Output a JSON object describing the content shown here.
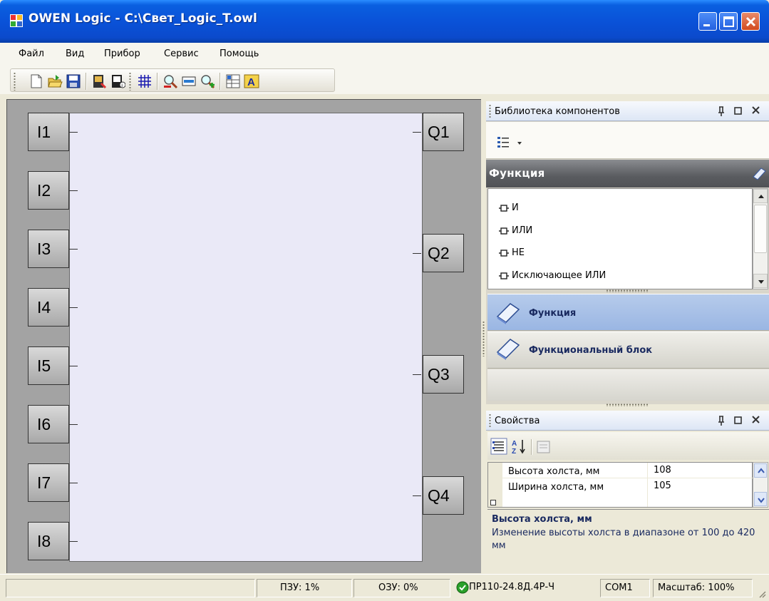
{
  "window": {
    "title": "OWEN Logic - C:\\Свет_Logic_T.owl"
  },
  "menu": [
    "Файл",
    "Вид",
    "Прибор",
    "Сервис",
    "Помощь"
  ],
  "canvas": {
    "inputs": [
      "I1",
      "I2",
      "I3",
      "I4",
      "I5",
      "I6",
      "I7",
      "I8"
    ],
    "outputs": [
      "Q1",
      "Q2",
      "Q3",
      "Q4"
    ]
  },
  "library": {
    "title": "Библиотека компонентов",
    "group_title": "Функция",
    "functions": [
      "И",
      "ИЛИ",
      "НЕ",
      "Исключающее ИЛИ"
    ],
    "categories": [
      "Функция",
      "Функциональный блок"
    ]
  },
  "properties": {
    "title": "Свойства",
    "rows": [
      {
        "name": "Высота холста, мм",
        "value": "108"
      },
      {
        "name": "Ширина холста, мм",
        "value": "105"
      }
    ],
    "description_title": "Высота холста, мм",
    "description_text": "Изменение высоты холста в диапазоне от 100 до 420 мм"
  },
  "status": {
    "rom": "ПЗУ: 1%",
    "ram": "ОЗУ: 0%",
    "device": "ПР110-24.8Д.4Р-Ч",
    "port": "COM1",
    "zoom": "Масштаб: 100%"
  },
  "colors": {
    "titlebar": "#0a52d8",
    "canvas_bg": "#a3a3a3",
    "device_bg": "#eae9f7",
    "selected_category": "#9ab6e3"
  }
}
